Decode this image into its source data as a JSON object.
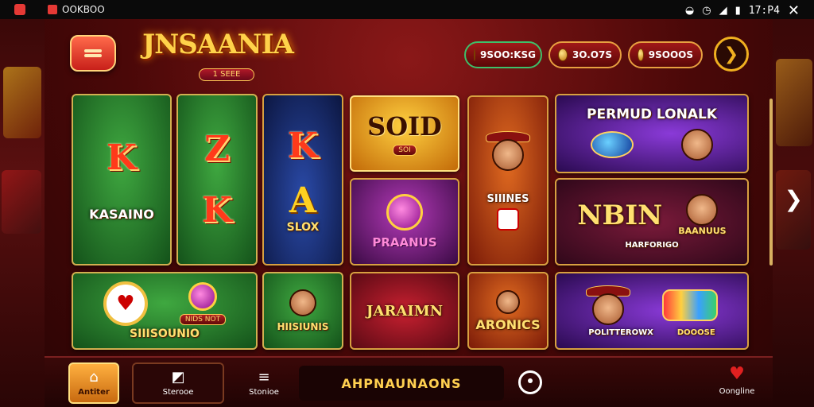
{
  "status_bar": {
    "app_text": "OOKBOO",
    "time": "17:P4",
    "icons": [
      "wifi-icon",
      "alarm-icon",
      "signal-icon",
      "battery-icon",
      "close-icon"
    ]
  },
  "header": {
    "logo_title": "JNSAANIA",
    "logo_sub": "1 SEEE",
    "pills": [
      {
        "value": "9SOO:KSG",
        "icon": "coin-icon",
        "style": "green"
      },
      {
        "value": "3O.O7S",
        "icon": "coin-icon",
        "style": "gold"
      },
      {
        "value": "9SOOOS",
        "icon": "coin-icon",
        "style": "gold"
      }
    ],
    "next_icon": "chevron-right-icon"
  },
  "games": [
    {
      "id": "kasaino",
      "glyph": "K",
      "label": "KASAINO"
    },
    {
      "id": "z-k",
      "glyph_top": "Z",
      "glyph_bottom": "K"
    },
    {
      "id": "k-slox",
      "glyph_top": "K",
      "glyph_mid": "A",
      "label": "SLOX"
    },
    {
      "id": "soid",
      "title": "SOID",
      "sub": "SOI"
    },
    {
      "id": "hat-man",
      "label": "SIIINES"
    },
    {
      "id": "permud",
      "title": "PERMUD LONALK"
    },
    {
      "id": "praanus",
      "label": "PRAANUS"
    },
    {
      "id": "nbin",
      "title": "NBIN",
      "sub": "BAANUUS",
      "footer": "HARFORIGO"
    },
    {
      "id": "siiisounio",
      "label": "SIIISOUNIO",
      "badge": "NIDS NOT"
    },
    {
      "id": "hiisiunis",
      "label": "HIISIUNIS"
    },
    {
      "id": "jaraimn",
      "label": "JARAIMN"
    },
    {
      "id": "aronics",
      "label": "ARONICS"
    },
    {
      "id": "politeswix",
      "footer_left": "POLITTEROWX",
      "footer_right": "DOOOSE"
    }
  ],
  "bottom_nav": {
    "home_label": "Antiter",
    "item2_label": "Sterooe",
    "item3_label": "Stonioe",
    "promo": "AHPNAUNAONS",
    "fav_label": "Oongline"
  }
}
